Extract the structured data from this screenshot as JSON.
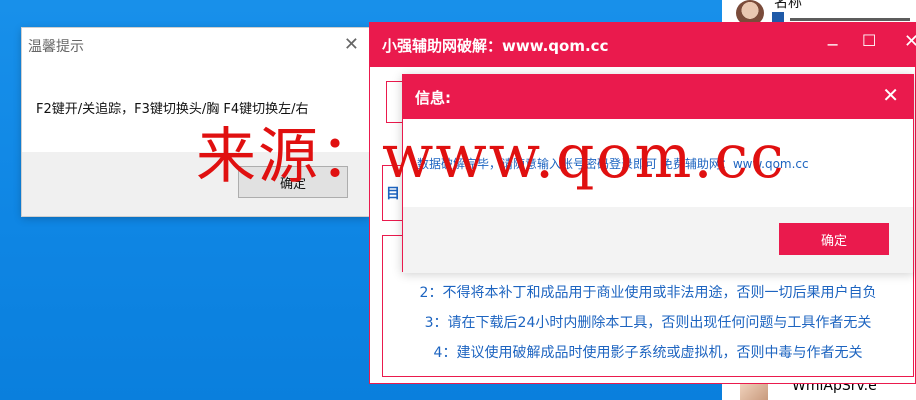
{
  "desktop": {
    "contact_name": "名称",
    "taskbar_item": "WmiApSrv.e"
  },
  "alert_dialog": {
    "title": "温馨提示",
    "message": "F2键开/关追踪，F3键切换头/胸 F4键切换左/右",
    "ok_label": "确定",
    "close_glyph": "✕"
  },
  "main_window": {
    "title": "小强辅助网破解：www.qom.cc",
    "min_glyph": "−",
    "max_glyph": "☐",
    "close_glyph": "✕",
    "side_label": "目",
    "rules": [
      "2：不得将本补丁和成品用于商业使用或非法用途，否则一切后果用户自负",
      "3：请在下载后24小时内删除本工具，否则出现任何问题与工具作者无关",
      "4：建议使用破解成品时使用影子系统或虚拟机，否则中毒与作者无关"
    ]
  },
  "info_dialog": {
    "title": "信息:",
    "message": "数据破解完毕，请随意输入账号密码登录即可 免费辅助网：www.qom.cc",
    "ok_label": "确定",
    "close_glyph": "✕"
  },
  "watermark": "来源：www.qom.cc",
  "colors": {
    "accent_red": "#ea1a4d",
    "link_blue": "#1d64c0",
    "desktop_blue": "#1088e6"
  }
}
